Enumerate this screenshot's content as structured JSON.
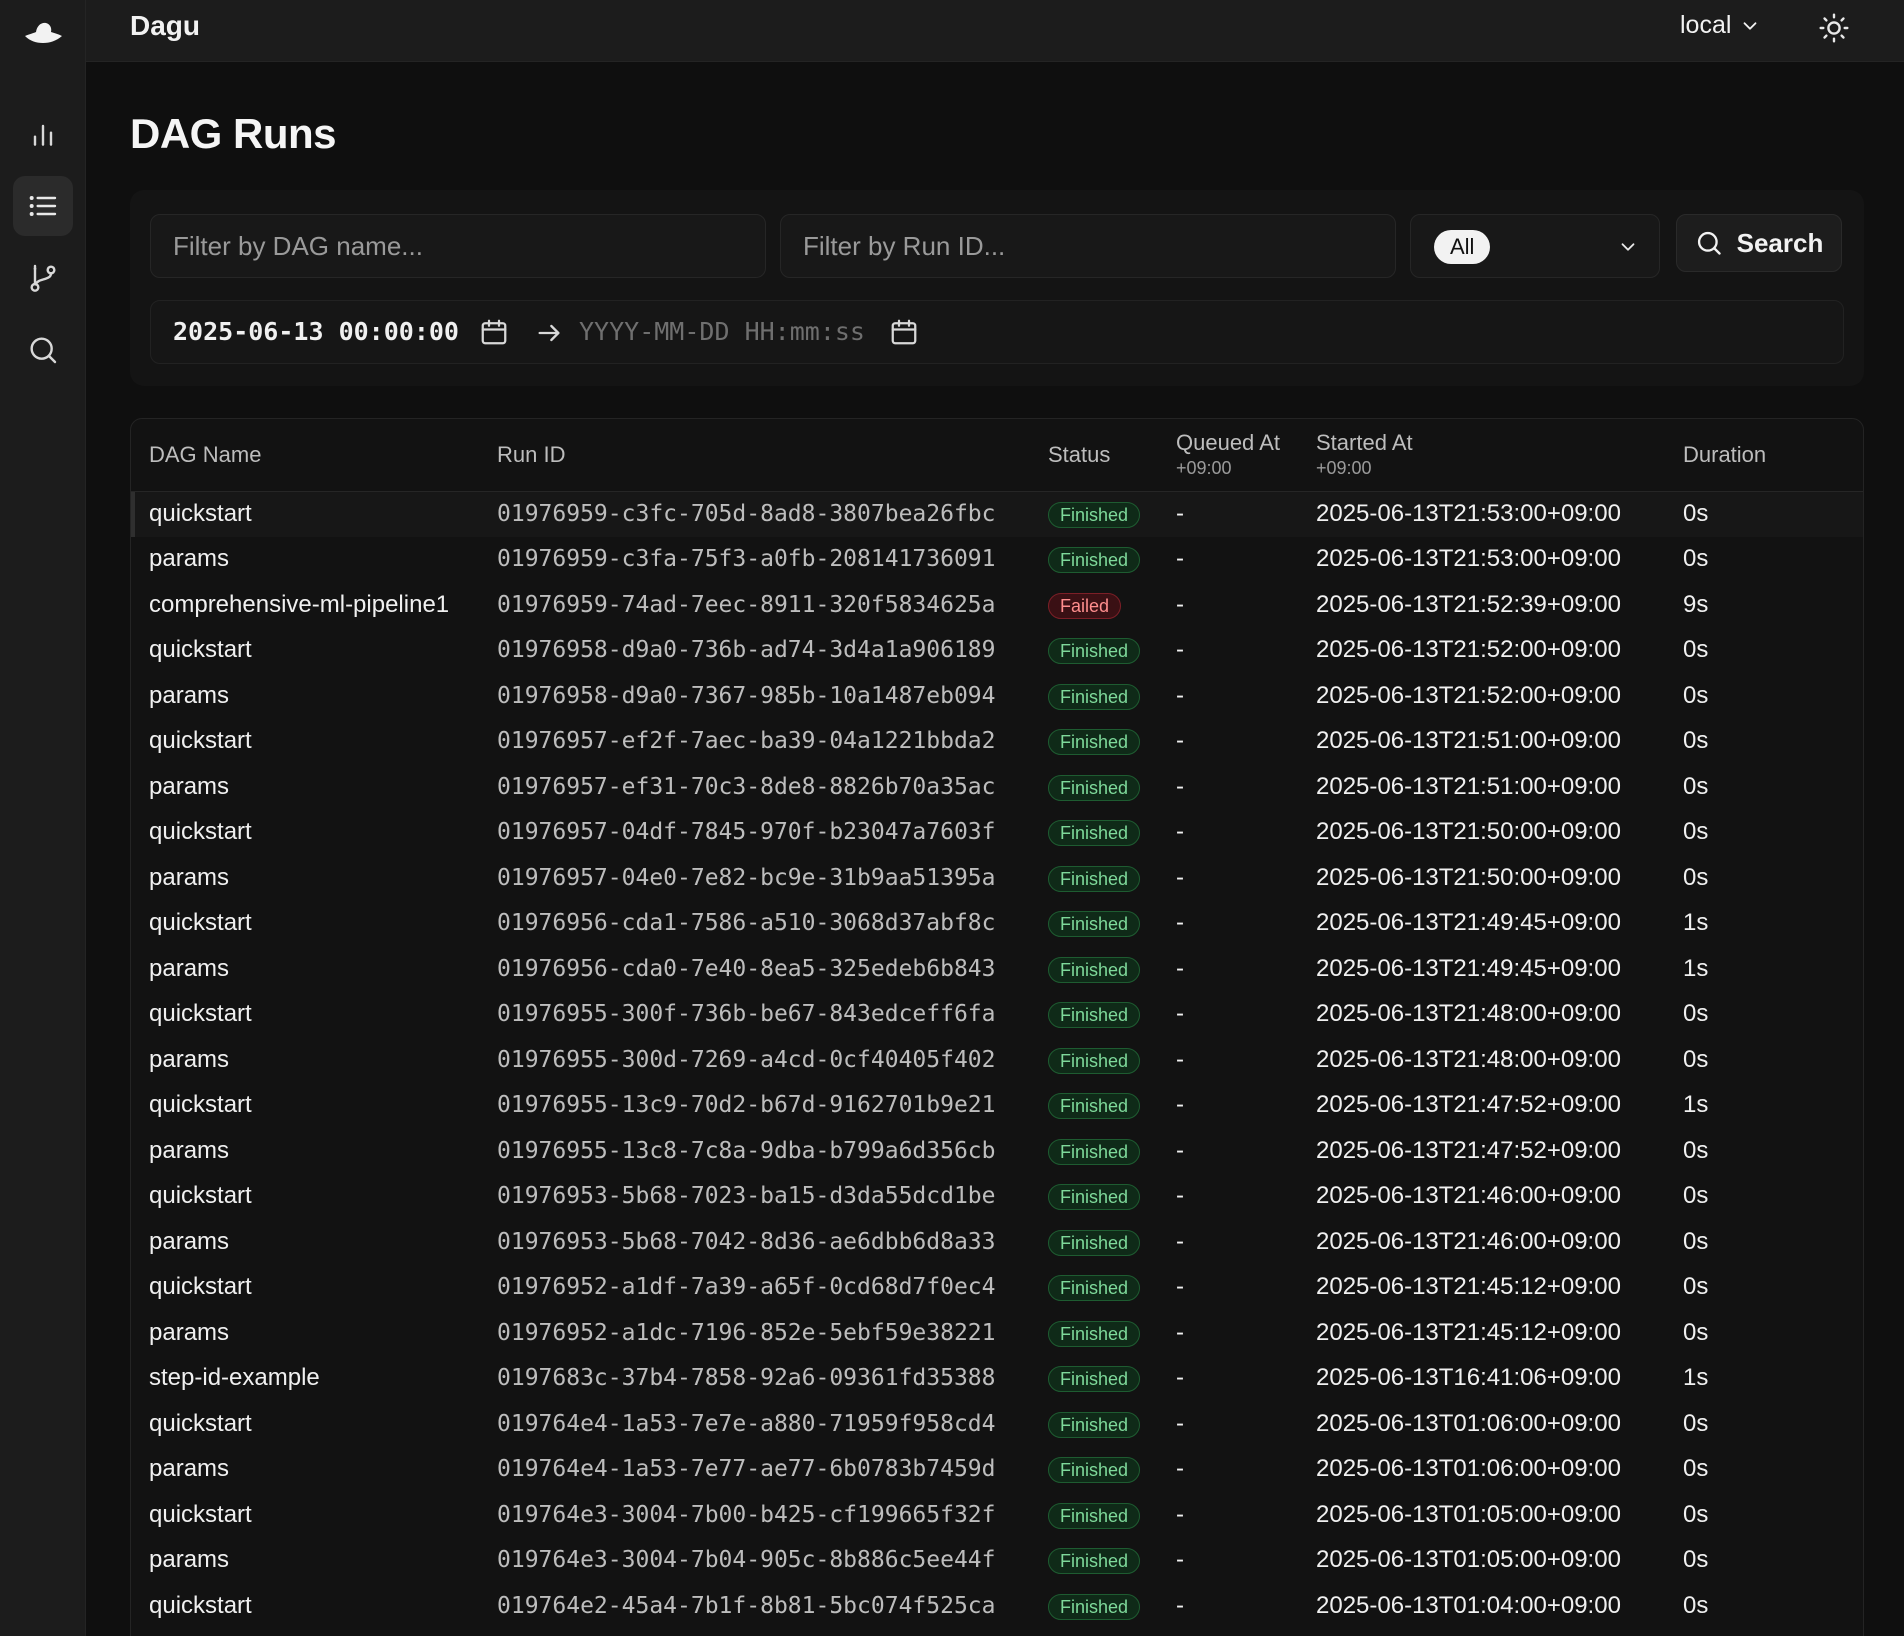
{
  "app": {
    "title": "Dagu",
    "environment": "local"
  },
  "colors": {
    "accent": "#f2f2f2",
    "finished": "#7ed99a",
    "failed": "#ff8e8e",
    "background": "#0f0f0f"
  },
  "sidebar": {
    "items": [
      {
        "name": "dashboard",
        "icon": "bar-chart-icon",
        "active": false
      },
      {
        "name": "dag-runs",
        "icon": "list-icon",
        "active": true
      },
      {
        "name": "dags",
        "icon": "git-branch-icon",
        "active": false
      },
      {
        "name": "search",
        "icon": "search-icon",
        "active": false
      }
    ]
  },
  "page": {
    "title": "DAG Runs"
  },
  "filters": {
    "dag_name_placeholder": "Filter by DAG name...",
    "run_id_placeholder": "Filter by Run ID...",
    "status_value": "All",
    "search_label": "Search",
    "date_start": "2025-06-13 00:00:00",
    "date_end_placeholder": "YYYY-MM-DD HH:mm:ss"
  },
  "table": {
    "columns": {
      "dag_name": "DAG Name",
      "run_id": "Run ID",
      "status": "Status",
      "queued_at": "Queued At",
      "queued_tz": "+09:00",
      "started_at": "Started At",
      "started_tz": "+09:00",
      "duration": "Duration"
    },
    "rows": [
      {
        "dag": "quickstart",
        "run_id": "01976959-c3fc-705d-8ad8-3807bea26fbc",
        "status": "Finished",
        "queued": "-",
        "started": "2025-06-13T21:53:00+09:00",
        "duration": "0s"
      },
      {
        "dag": "params",
        "run_id": "01976959-c3fa-75f3-a0fb-208141736091",
        "status": "Finished",
        "queued": "-",
        "started": "2025-06-13T21:53:00+09:00",
        "duration": "0s"
      },
      {
        "dag": "comprehensive-ml-pipeline1",
        "run_id": "01976959-74ad-7eec-8911-320f5834625a",
        "status": "Failed",
        "queued": "-",
        "started": "2025-06-13T21:52:39+09:00",
        "duration": "9s"
      },
      {
        "dag": "quickstart",
        "run_id": "01976958-d9a0-736b-ad74-3d4a1a906189",
        "status": "Finished",
        "queued": "-",
        "started": "2025-06-13T21:52:00+09:00",
        "duration": "0s"
      },
      {
        "dag": "params",
        "run_id": "01976958-d9a0-7367-985b-10a1487eb094",
        "status": "Finished",
        "queued": "-",
        "started": "2025-06-13T21:52:00+09:00",
        "duration": "0s"
      },
      {
        "dag": "quickstart",
        "run_id": "01976957-ef2f-7aec-ba39-04a1221bbda2",
        "status": "Finished",
        "queued": "-",
        "started": "2025-06-13T21:51:00+09:00",
        "duration": "0s"
      },
      {
        "dag": "params",
        "run_id": "01976957-ef31-70c3-8de8-8826b70a35ac",
        "status": "Finished",
        "queued": "-",
        "started": "2025-06-13T21:51:00+09:00",
        "duration": "0s"
      },
      {
        "dag": "quickstart",
        "run_id": "01976957-04df-7845-970f-b23047a7603f",
        "status": "Finished",
        "queued": "-",
        "started": "2025-06-13T21:50:00+09:00",
        "duration": "0s"
      },
      {
        "dag": "params",
        "run_id": "01976957-04e0-7e82-bc9e-31b9aa51395a",
        "status": "Finished",
        "queued": "-",
        "started": "2025-06-13T21:50:00+09:00",
        "duration": "0s"
      },
      {
        "dag": "quickstart",
        "run_id": "01976956-cda1-7586-a510-3068d37abf8c",
        "status": "Finished",
        "queued": "-",
        "started": "2025-06-13T21:49:45+09:00",
        "duration": "1s"
      },
      {
        "dag": "params",
        "run_id": "01976956-cda0-7e40-8ea5-325edeb6b843",
        "status": "Finished",
        "queued": "-",
        "started": "2025-06-13T21:49:45+09:00",
        "duration": "1s"
      },
      {
        "dag": "quickstart",
        "run_id": "01976955-300f-736b-be67-843edceff6fa",
        "status": "Finished",
        "queued": "-",
        "started": "2025-06-13T21:48:00+09:00",
        "duration": "0s"
      },
      {
        "dag": "params",
        "run_id": "01976955-300d-7269-a4cd-0cf40405f402",
        "status": "Finished",
        "queued": "-",
        "started": "2025-06-13T21:48:00+09:00",
        "duration": "0s"
      },
      {
        "dag": "quickstart",
        "run_id": "01976955-13c9-70d2-b67d-9162701b9e21",
        "status": "Finished",
        "queued": "-",
        "started": "2025-06-13T21:47:52+09:00",
        "duration": "1s"
      },
      {
        "dag": "params",
        "run_id": "01976955-13c8-7c8a-9dba-b799a6d356cb",
        "status": "Finished",
        "queued": "-",
        "started": "2025-06-13T21:47:52+09:00",
        "duration": "0s"
      },
      {
        "dag": "quickstart",
        "run_id": "01976953-5b68-7023-ba15-d3da55dcd1be",
        "status": "Finished",
        "queued": "-",
        "started": "2025-06-13T21:46:00+09:00",
        "duration": "0s"
      },
      {
        "dag": "params",
        "run_id": "01976953-5b68-7042-8d36-ae6dbb6d8a33",
        "status": "Finished",
        "queued": "-",
        "started": "2025-06-13T21:46:00+09:00",
        "duration": "0s"
      },
      {
        "dag": "quickstart",
        "run_id": "01976952-a1df-7a39-a65f-0cd68d7f0ec4",
        "status": "Finished",
        "queued": "-",
        "started": "2025-06-13T21:45:12+09:00",
        "duration": "0s"
      },
      {
        "dag": "params",
        "run_id": "01976952-a1dc-7196-852e-5ebf59e38221",
        "status": "Finished",
        "queued": "-",
        "started": "2025-06-13T21:45:12+09:00",
        "duration": "0s"
      },
      {
        "dag": "step-id-example",
        "run_id": "0197683c-37b4-7858-92a6-09361fd35388",
        "status": "Finished",
        "queued": "-",
        "started": "2025-06-13T16:41:06+09:00",
        "duration": "1s"
      },
      {
        "dag": "quickstart",
        "run_id": "019764e4-1a53-7e7e-a880-71959f958cd4",
        "status": "Finished",
        "queued": "-",
        "started": "2025-06-13T01:06:00+09:00",
        "duration": "0s"
      },
      {
        "dag": "params",
        "run_id": "019764e4-1a53-7e77-ae77-6b0783b7459d",
        "status": "Finished",
        "queued": "-",
        "started": "2025-06-13T01:06:00+09:00",
        "duration": "0s"
      },
      {
        "dag": "quickstart",
        "run_id": "019764e3-3004-7b00-b425-cf199665f32f",
        "status": "Finished",
        "queued": "-",
        "started": "2025-06-13T01:05:00+09:00",
        "duration": "0s"
      },
      {
        "dag": "params",
        "run_id": "019764e3-3004-7b04-905c-8b886c5ee44f",
        "status": "Finished",
        "queued": "-",
        "started": "2025-06-13T01:05:00+09:00",
        "duration": "0s"
      },
      {
        "dag": "quickstart",
        "run_id": "019764e2-45a4-7b1f-8b81-5bc074f525ca",
        "status": "Finished",
        "queued": "-",
        "started": "2025-06-13T01:04:00+09:00",
        "duration": "0s"
      }
    ]
  }
}
